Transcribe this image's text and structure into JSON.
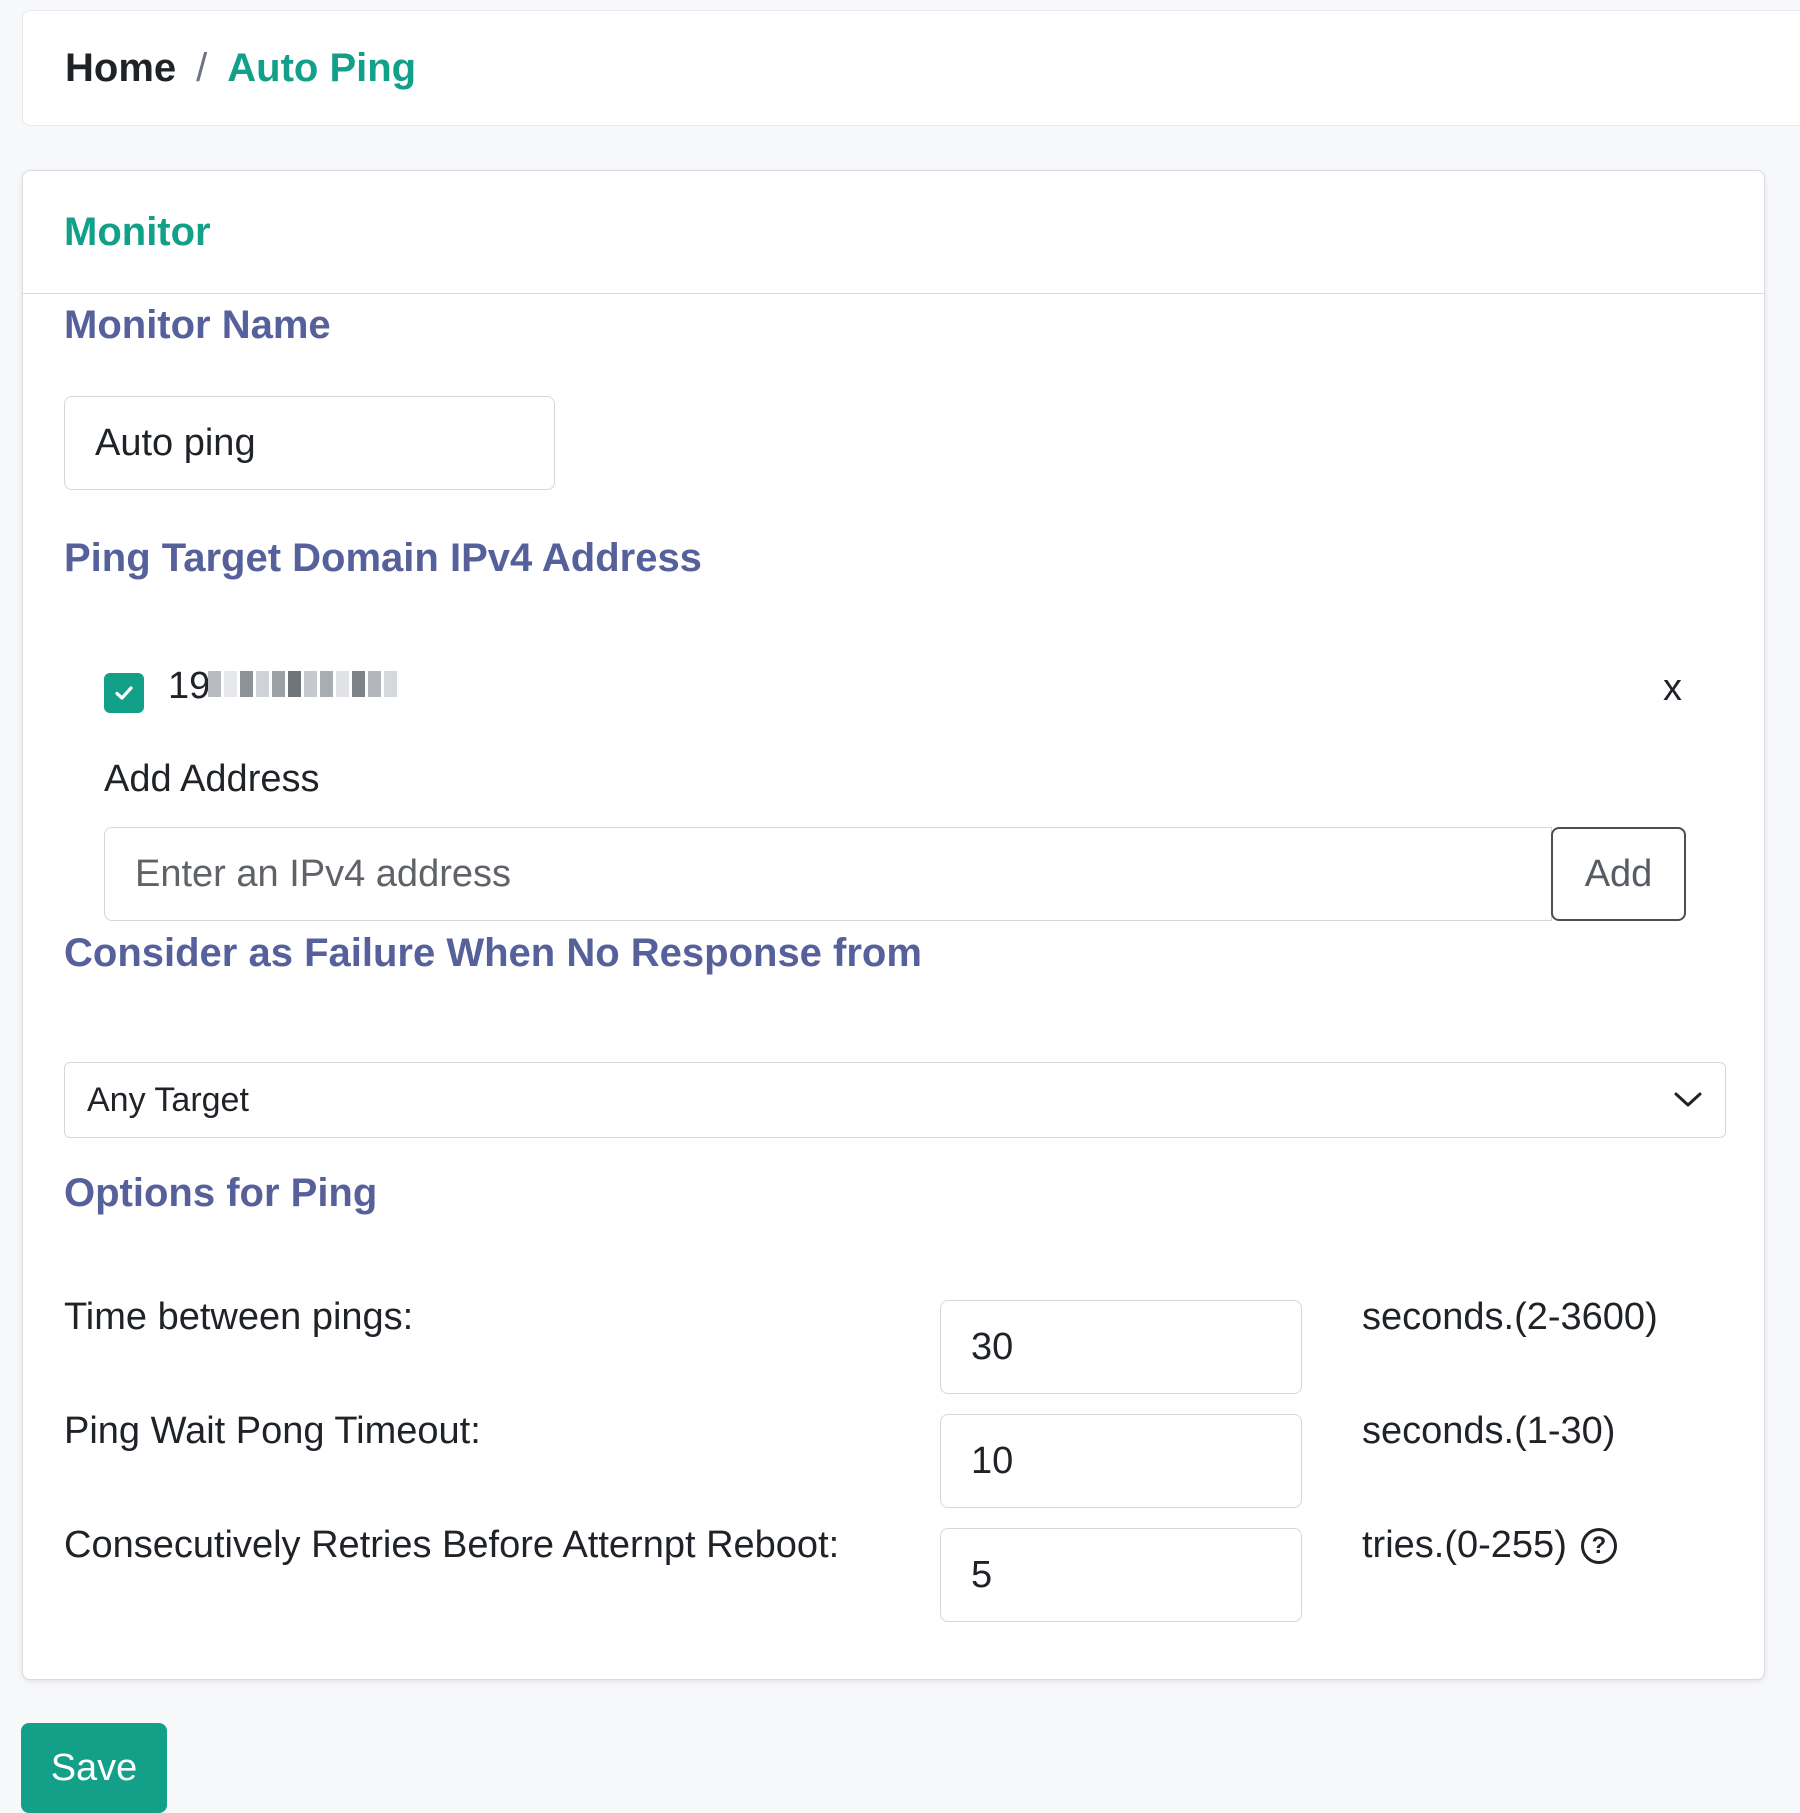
{
  "breadcrumb": {
    "home": "Home",
    "separator": "/",
    "current": "Auto Ping"
  },
  "card": {
    "title": "Monitor"
  },
  "monitor_name": {
    "label": "Monitor Name",
    "value": "Auto ping"
  },
  "targets": {
    "label": "Ping Target Domain IPv4 Address",
    "items": [
      {
        "address_visible": "19",
        "checked": true,
        "remove_label": "x"
      }
    ],
    "add_label": "Add Address",
    "input_placeholder": "Enter an IPv4 address",
    "add_button": "Add"
  },
  "failure": {
    "label": "Consider as Failure When No Response from",
    "selected": "Any Target"
  },
  "options": {
    "title": "Options for Ping",
    "rows": [
      {
        "label": "Time between pings:",
        "value": "30",
        "unit": "seconds.(2-3600)"
      },
      {
        "label": "Ping Wait Pong Timeout:",
        "value": "10",
        "unit": "seconds.(1-30)"
      },
      {
        "label": "Consecutively Retries Before Atternpt Reboot:",
        "value": "5",
        "unit": "tries.(0-255)"
      }
    ],
    "help_icon_glyph": "?"
  },
  "save_button": "Save",
  "colors": {
    "accent": "#12a088",
    "section_title": "#56609a"
  }
}
